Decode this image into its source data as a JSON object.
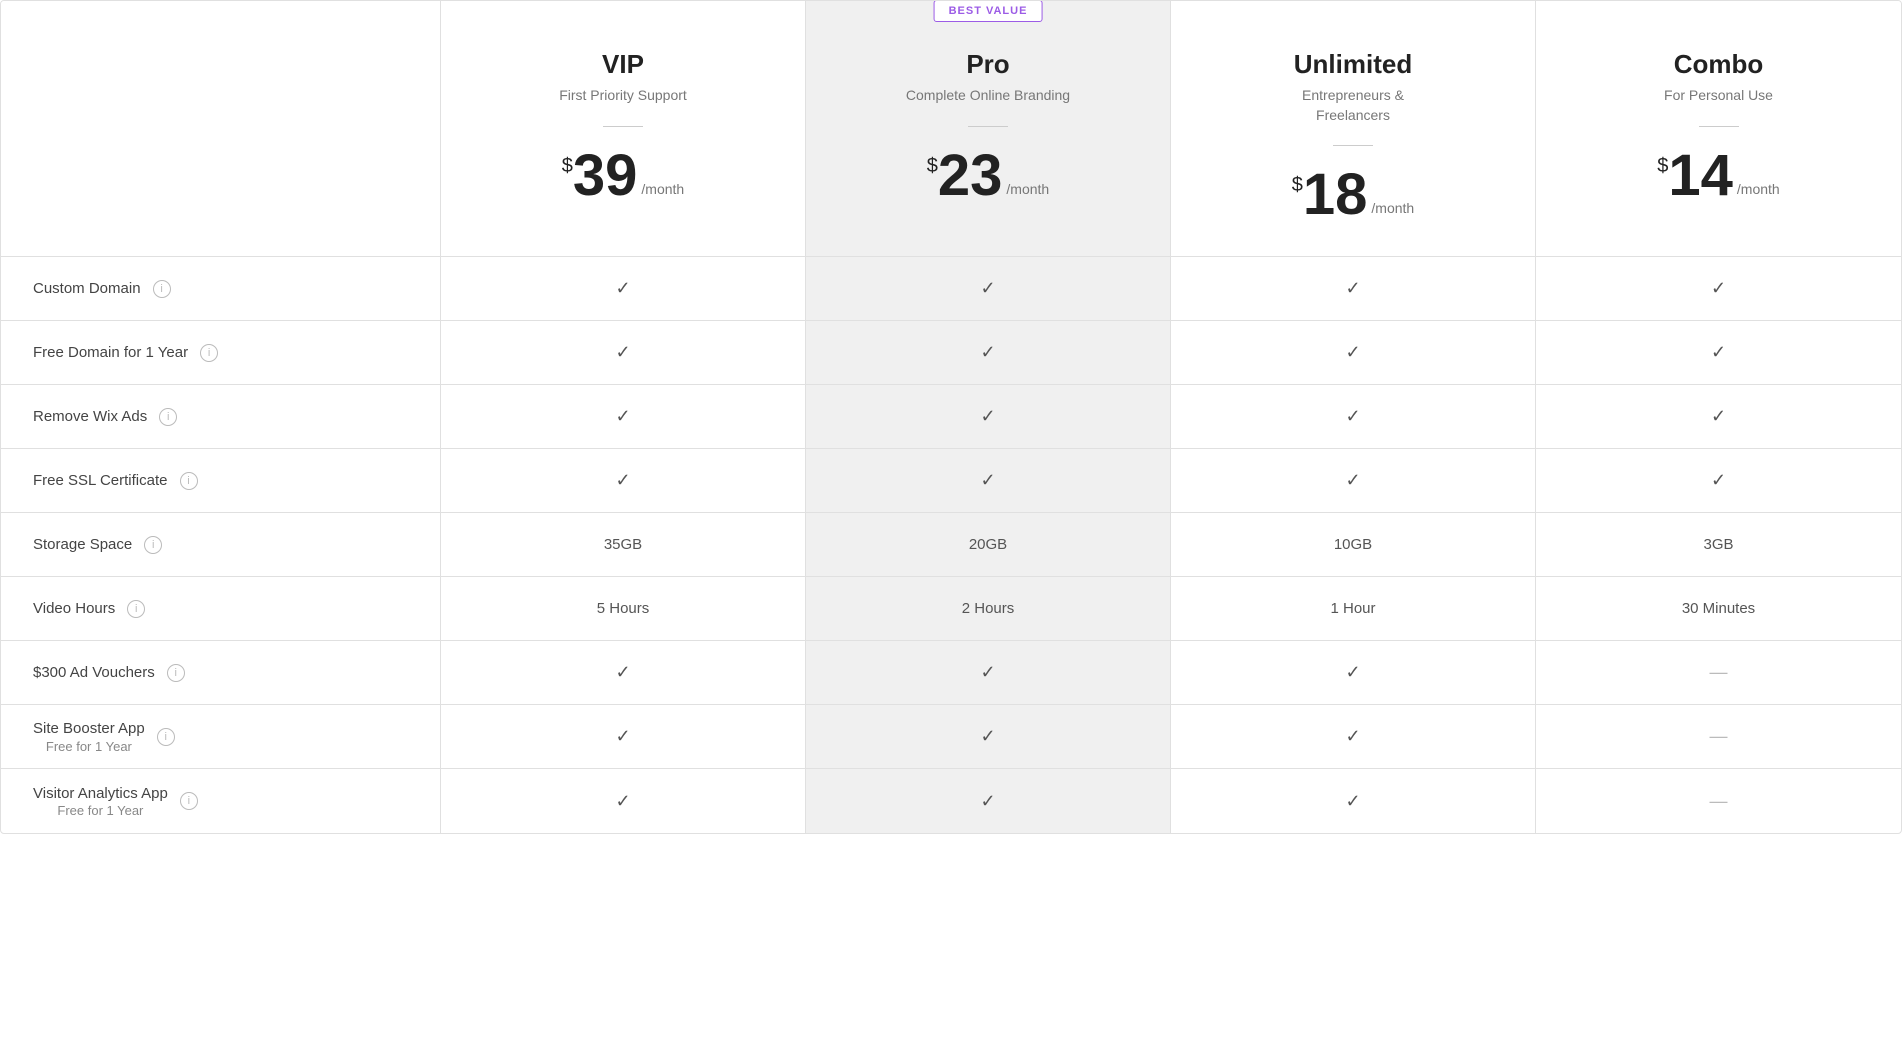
{
  "badge": {
    "label": "BEST VALUE"
  },
  "plans": [
    {
      "id": "vip",
      "name": "VIP",
      "tagline": "First Priority Support",
      "price_dollar": "$",
      "price_amount": "39",
      "price_period": "/month",
      "is_pro": false
    },
    {
      "id": "pro",
      "name": "Pro",
      "tagline": "Complete Online Branding",
      "price_dollar": "$",
      "price_amount": "23",
      "price_period": "/month",
      "is_pro": true
    },
    {
      "id": "unlimited",
      "name": "Unlimited",
      "tagline": "Entrepreneurs &\nFreelancers",
      "price_dollar": "$",
      "price_amount": "18",
      "price_period": "/month",
      "is_pro": false
    },
    {
      "id": "combo",
      "name": "Combo",
      "tagline": "For Personal Use",
      "price_dollar": "$",
      "price_amount": "14",
      "price_period": "/month",
      "is_pro": false
    }
  ],
  "features": [
    {
      "label": "Custom Domain",
      "sublabel": "",
      "values": [
        "check",
        "check",
        "check",
        "check"
      ]
    },
    {
      "label": "Free Domain for 1 Year",
      "sublabel": "",
      "values": [
        "check",
        "check",
        "check",
        "check"
      ]
    },
    {
      "label": "Remove Wix Ads",
      "sublabel": "",
      "values": [
        "check",
        "check",
        "check",
        "check"
      ]
    },
    {
      "label": "Free SSL Certificate",
      "sublabel": "",
      "values": [
        "check",
        "check",
        "check",
        "check"
      ]
    },
    {
      "label": "Storage Space",
      "sublabel": "",
      "values": [
        "35GB",
        "20GB",
        "10GB",
        "3GB"
      ]
    },
    {
      "label": "Video Hours",
      "sublabel": "",
      "values": [
        "5 Hours",
        "2 Hours",
        "1 Hour",
        "30 Minutes"
      ]
    },
    {
      "label": "$300 Ad Vouchers",
      "sublabel": "",
      "values": [
        "check",
        "check",
        "check",
        "dash"
      ]
    },
    {
      "label": "Site Booster App",
      "sublabel": "Free for 1 Year",
      "values": [
        "check",
        "check",
        "check",
        "dash"
      ]
    },
    {
      "label": "Visitor Analytics App",
      "sublabel": "Free for 1 Year",
      "values": [
        "check",
        "check",
        "check",
        "dash"
      ]
    }
  ]
}
